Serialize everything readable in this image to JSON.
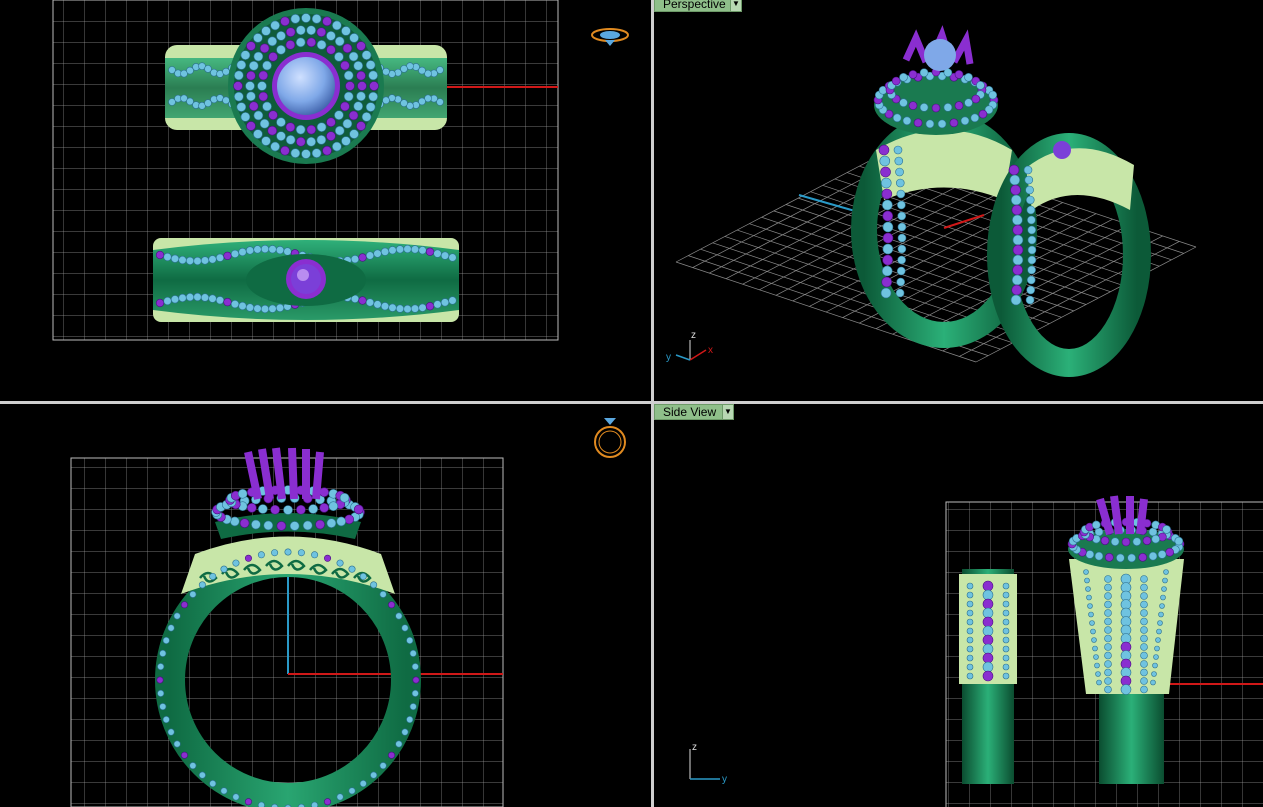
{
  "viewports": {
    "perspective": {
      "label": "Perspective"
    },
    "side": {
      "label": "Side View"
    }
  },
  "axis_labels": {
    "x": "x",
    "y": "y",
    "z": "z"
  },
  "colors": {
    "metal_green": "#1e8a5a",
    "metal_light": "#c8e6a8",
    "gem_blue": "#7fa8e8",
    "gem_purple": "#8a2ed0",
    "grid": "#9a9a9a",
    "axis_x": "#d01818",
    "axis_y": "#2a9ac8",
    "label_bg": "#8fbf8a"
  },
  "icons": [
    "ring-top-icon",
    "ring-front-icon",
    "dropdown-arrow-icon"
  ]
}
